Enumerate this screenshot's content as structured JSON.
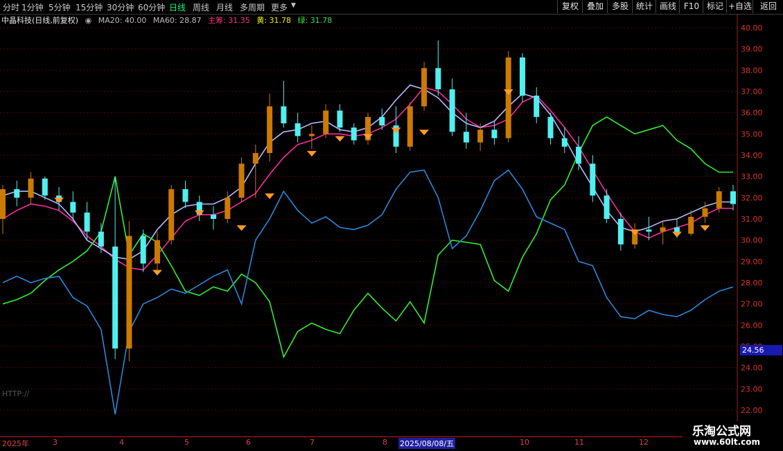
{
  "toolbar": {
    "periods": [
      "分时",
      "1分钟",
      "5分钟",
      "15分钟",
      "30分钟",
      "60分钟",
      "日线",
      "周线",
      "月线",
      "多周期",
      "更多"
    ],
    "active_period": "日线",
    "buttons": [
      "复权",
      "叠加",
      "多股",
      "统计",
      "画线",
      "F10",
      "标记",
      "+自选",
      "返回"
    ]
  },
  "legend": {
    "stock": "中晶科技(日线,前复权)",
    "ma20": "MA20: 40.00",
    "ma60": "MA60: 28.87",
    "main": "主筹: 31.35",
    "yellow": "黄: 31.78",
    "green": "绿: 31.78"
  },
  "colors": {
    "background": "#000000",
    "grid": "#5a0000",
    "axis_text": "#e03030",
    "candle_up_fill": "#cc7a00",
    "candle_down": "#50f0f0",
    "ma_line": "#ff2aa0",
    "lavender_lines": "#b8b8ff",
    "green_line": "#33ee33",
    "blue_line": "#2a88d8",
    "marker": "#ff9a2a",
    "legend_main": "#ff3080",
    "legend_yellow": "#f0f000",
    "legend_green": "#40e040"
  },
  "price_axis": {
    "ticks": [
      "40.00",
      "39.00",
      "38.00",
      "37.00",
      "36.00",
      "35.00",
      "34.00",
      "33.00",
      "32.00",
      "31.00",
      "30.00",
      "29.00",
      "28.00",
      "27.00",
      "26.00",
      "25.00",
      "24.00",
      "23.00",
      "22.00"
    ],
    "current_price_label": "24.56"
  },
  "x_axis": {
    "labels": [
      "2025年",
      "3",
      "4",
      "5",
      "6",
      "7",
      "8",
      "2025/08/08/五",
      "10",
      "11",
      "12"
    ],
    "selected": "2025/08/08/五"
  },
  "side_text": [
    "HTTP://"
  ],
  "watermark": {
    "title": "乐淘公式网",
    "url": "www.60lt.com"
  },
  "chart_data": {
    "type": "line",
    "title": "中晶科技(日线,前复权)",
    "ylim": [
      21.5,
      40.5
    ],
    "grid": true,
    "x_label": "",
    "y_label": "",
    "series": [
      {
        "name": "主筹",
        "values": [
          31.0,
          31.4,
          31.7,
          31.6,
          31.4,
          30.9,
          30.2,
          29.7,
          29.1,
          28.7,
          28.6,
          29.3,
          30.1,
          30.9,
          31.2,
          31.2,
          31.4,
          31.8,
          32.2,
          33.1,
          33.9,
          34.5,
          34.7,
          35.0,
          35.0,
          34.9,
          35.0,
          35.3,
          35.7,
          36.4,
          37.2,
          37.0,
          36.4,
          35.7,
          35.3,
          35.4,
          35.7,
          36.5,
          36.8,
          36.1,
          35.3,
          34.4,
          33.3,
          32.2,
          31.2,
          30.4,
          30.1,
          30.4,
          30.6,
          30.8,
          31.2,
          31.5,
          31.5
        ]
      },
      {
        "name": "黄",
        "values": [
          32.1,
          32.3,
          32.3,
          32.0,
          31.7,
          31.0,
          30.0,
          29.6,
          29.2,
          29.1,
          29.5,
          30.5,
          31.2,
          31.6,
          31.7,
          31.7,
          32.0,
          32.5,
          33.6,
          34.6,
          35.1,
          35.2,
          35.5,
          35.6,
          35.2,
          35.1,
          35.3,
          35.8,
          36.6,
          37.3,
          37.1,
          36.7,
          36.0,
          35.5,
          35.3,
          35.6,
          36.3,
          36.9,
          36.7,
          35.9,
          34.8,
          33.6,
          32.5,
          31.4,
          30.6,
          30.4,
          30.6,
          30.9,
          31.0,
          31.3,
          31.6,
          31.8,
          31.8
        ]
      },
      {
        "name": "绿",
        "values": [
          27.0,
          27.2,
          27.5,
          28.1,
          28.6,
          29.0,
          29.5,
          30.4,
          33.0,
          29.3,
          30.3,
          29.9,
          28.8,
          27.6,
          27.4,
          27.8,
          27.6,
          28.4,
          28.0,
          27.1,
          24.5,
          25.7,
          26.1,
          25.8,
          25.6,
          26.7,
          27.5,
          26.8,
          26.2,
          27.1,
          26.1,
          29.3,
          30.0,
          29.9,
          29.8,
          28.1,
          27.6,
          29.2,
          30.3,
          31.9,
          32.6,
          34.1,
          35.4,
          35.8,
          35.4,
          35.0,
          35.2,
          35.4,
          34.7,
          34.3,
          33.6,
          33.2,
          33.2
        ]
      },
      {
        "name": "",
        "values": [
          28.0,
          28.3,
          28.0,
          28.2,
          28.3,
          27.3,
          26.9,
          25.8,
          21.8,
          25.7,
          27.0,
          27.3,
          27.7,
          27.5,
          27.9,
          28.3,
          28.6,
          27.0,
          30.0,
          31.0,
          32.3,
          31.4,
          30.8,
          31.1,
          30.6,
          30.5,
          30.7,
          31.2,
          32.4,
          33.2,
          33.3,
          32.0,
          29.6,
          30.2,
          31.4,
          32.8,
          33.3,
          32.4,
          31.1,
          30.8,
          30.5,
          29.0,
          28.8,
          27.3,
          26.4,
          26.3,
          26.7,
          26.5,
          26.4,
          26.7,
          27.2,
          27.6,
          27.8
        ]
      }
    ],
    "candles": [
      [
        31.0,
        32.6,
        30.3,
        32.4
      ],
      [
        32.4,
        32.8,
        31.6,
        32.0
      ],
      [
        32.0,
        33.2,
        31.7,
        32.9
      ],
      [
        32.9,
        33.0,
        31.9,
        32.1
      ],
      [
        32.1,
        32.5,
        31.4,
        31.8
      ],
      [
        31.8,
        32.3,
        31.0,
        31.3
      ],
      [
        31.3,
        31.8,
        30.0,
        30.4
      ],
      [
        30.4,
        30.8,
        29.4,
        29.7
      ],
      [
        29.7,
        33.0,
        24.4,
        24.9
      ],
      [
        24.9,
        30.9,
        24.3,
        30.2
      ],
      [
        30.2,
        30.5,
        28.5,
        28.9
      ],
      [
        28.9,
        30.4,
        28.4,
        30.0
      ],
      [
        30.0,
        32.6,
        29.8,
        32.4
      ],
      [
        32.4,
        32.8,
        31.5,
        31.8
      ],
      [
        31.8,
        32.1,
        30.9,
        31.2
      ],
      [
        31.2,
        31.6,
        30.5,
        31.0
      ],
      [
        31.0,
        32.3,
        30.8,
        32.0
      ],
      [
        32.0,
        33.9,
        31.8,
        33.6
      ],
      [
        33.6,
        34.5,
        32.0,
        34.1
      ],
      [
        34.1,
        36.9,
        33.7,
        36.3
      ],
      [
        36.3,
        37.5,
        35.3,
        35.5
      ],
      [
        35.5,
        36.0,
        34.6,
        34.9
      ],
      [
        34.9,
        35.4,
        34.3,
        35.0
      ],
      [
        35.0,
        36.4,
        34.8,
        36.1
      ],
      [
        36.1,
        36.4,
        35.1,
        35.3
      ],
      [
        35.3,
        35.5,
        34.5,
        34.7
      ],
      [
        34.7,
        36.0,
        34.5,
        35.8
      ],
      [
        35.8,
        36.2,
        35.2,
        35.4
      ],
      [
        35.4,
        36.3,
        34.1,
        34.4
      ],
      [
        34.4,
        36.5,
        34.2,
        36.3
      ],
      [
        36.3,
        38.4,
        36.1,
        38.1
      ],
      [
        38.1,
        39.4,
        36.8,
        37.1
      ],
      [
        37.1,
        37.6,
        34.9,
        35.1
      ],
      [
        35.1,
        36.0,
        34.3,
        34.6
      ],
      [
        34.6,
        35.5,
        34.2,
        35.2
      ],
      [
        35.2,
        35.6,
        34.5,
        34.8
      ],
      [
        34.8,
        38.9,
        34.6,
        38.6
      ],
      [
        38.6,
        38.8,
        36.5,
        36.8
      ],
      [
        36.8,
        37.2,
        35.5,
        35.8
      ],
      [
        35.8,
        36.0,
        34.5,
        34.8
      ],
      [
        34.8,
        35.3,
        34.1,
        34.4
      ],
      [
        34.4,
        34.9,
        33.3,
        33.6
      ],
      [
        33.6,
        34.0,
        31.8,
        32.1
      ],
      [
        32.1,
        32.4,
        30.8,
        31.0
      ],
      [
        31.0,
        31.3,
        29.5,
        29.8
      ],
      [
        29.8,
        30.8,
        29.6,
        30.5
      ],
      [
        30.5,
        31.1,
        30.0,
        30.4
      ],
      [
        30.4,
        30.9,
        29.8,
        30.6
      ],
      [
        30.6,
        31.0,
        30.1,
        30.3
      ],
      [
        30.3,
        31.4,
        30.2,
        31.1
      ],
      [
        31.1,
        31.8,
        30.8,
        31.5
      ],
      [
        31.5,
        32.5,
        31.3,
        32.3
      ],
      [
        32.3,
        32.6,
        31.4,
        31.7
      ]
    ],
    "markers": [
      31.9,
      28.5,
      31.3,
      30.6,
      32.1,
      34.1,
      34.8,
      34.9,
      35.2,
      35.1,
      37.0,
      30.4,
      30.3,
      30.6
    ]
  }
}
